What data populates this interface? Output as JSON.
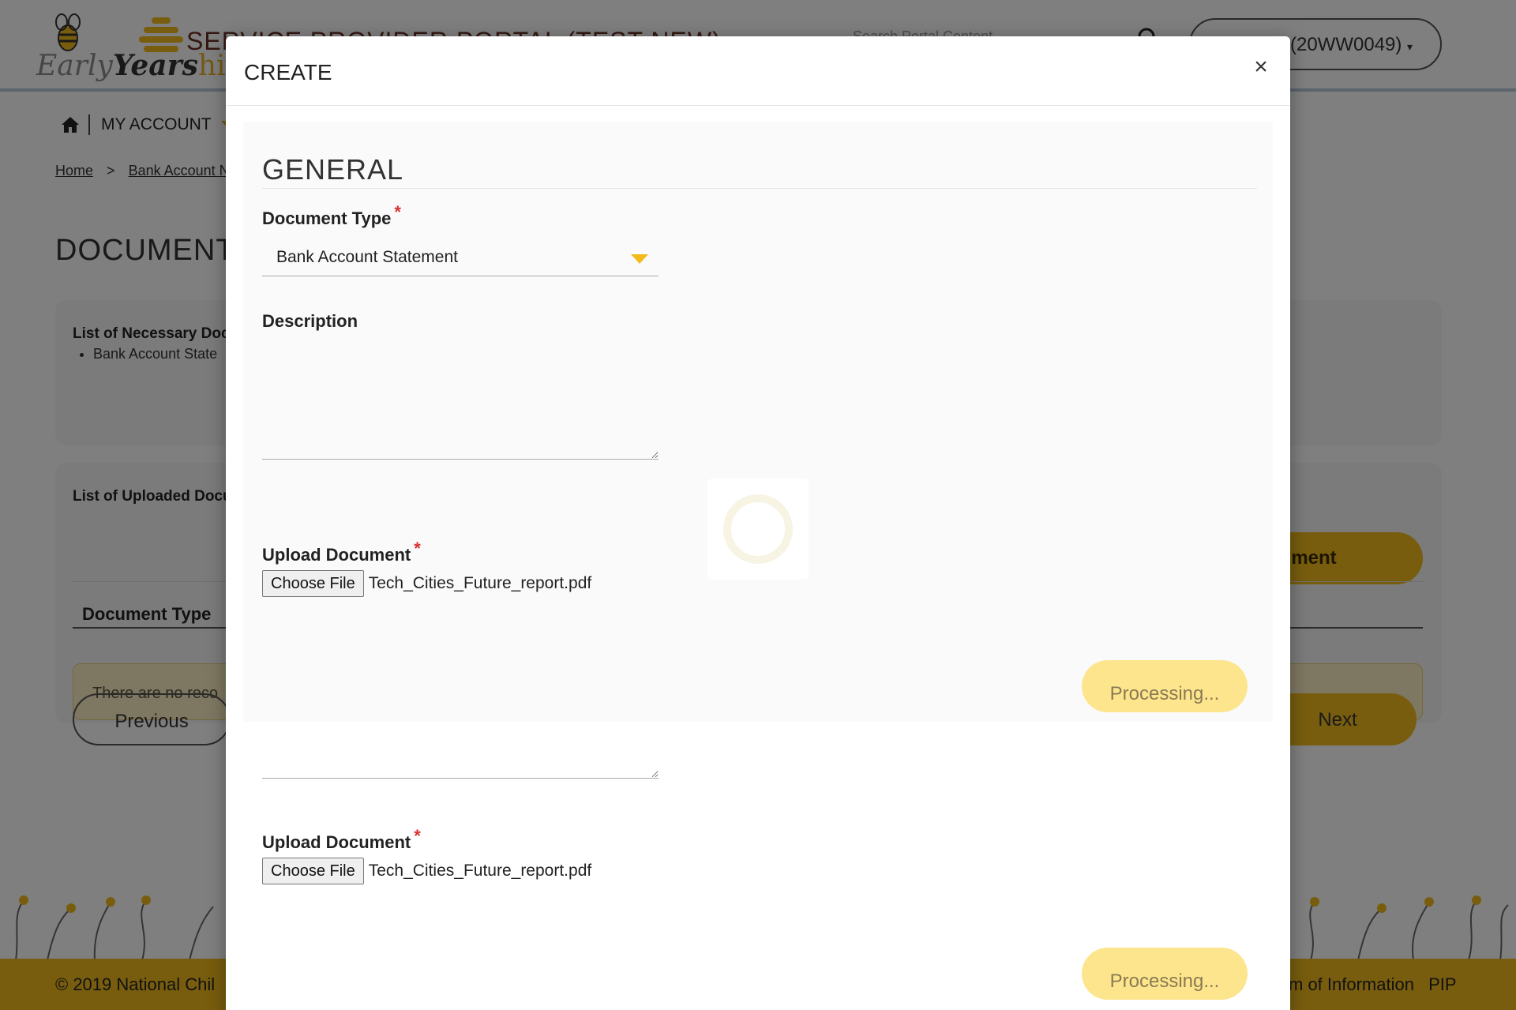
{
  "header": {
    "logo_text_early": "Early",
    "logo_text_years": "Years",
    "logo_text_hive": "hive",
    "portal_title": "SERVICE PROVIDER PORTAL (TEST NEW)",
    "search_placeholder": "Search Portal Content",
    "account_label": "(20WW0049)",
    "account_caret": "▾"
  },
  "nav": {
    "my_account": "MY ACCOUNT"
  },
  "breadcrumb": {
    "home": "Home",
    "sep": ">",
    "current": "Bank Account N"
  },
  "page": {
    "heading": "DOCUMENT",
    "necessary_title": "List of Necessary Docu",
    "necessary_items": [
      "Bank Account State"
    ],
    "uploaded_title": "List of Uploaded Docu",
    "upload_button": "d Document",
    "col_document_type": "Document Type",
    "no_records": "There are no reco",
    "previous": "Previous",
    "next": "Next"
  },
  "footer": {
    "copyright": "© 2019 National Chil",
    "link_foi": "m of Information",
    "link_pip": "PIP"
  },
  "modal": {
    "title": "CREATE",
    "close": "×",
    "section_general": "GENERAL",
    "document_type_label": "Document Type",
    "required_mark": "*",
    "document_type_value": "Bank Account Statement",
    "description_label": "Description",
    "upload_label": "Upload Document",
    "choose_file": "Choose File",
    "file_name": "Tech_Cities_Future_report.pdf",
    "processing": "Processing..."
  },
  "colors": {
    "accent": "#f1bb1c",
    "processing_bg": "#fde58d",
    "required": "#d83030"
  }
}
